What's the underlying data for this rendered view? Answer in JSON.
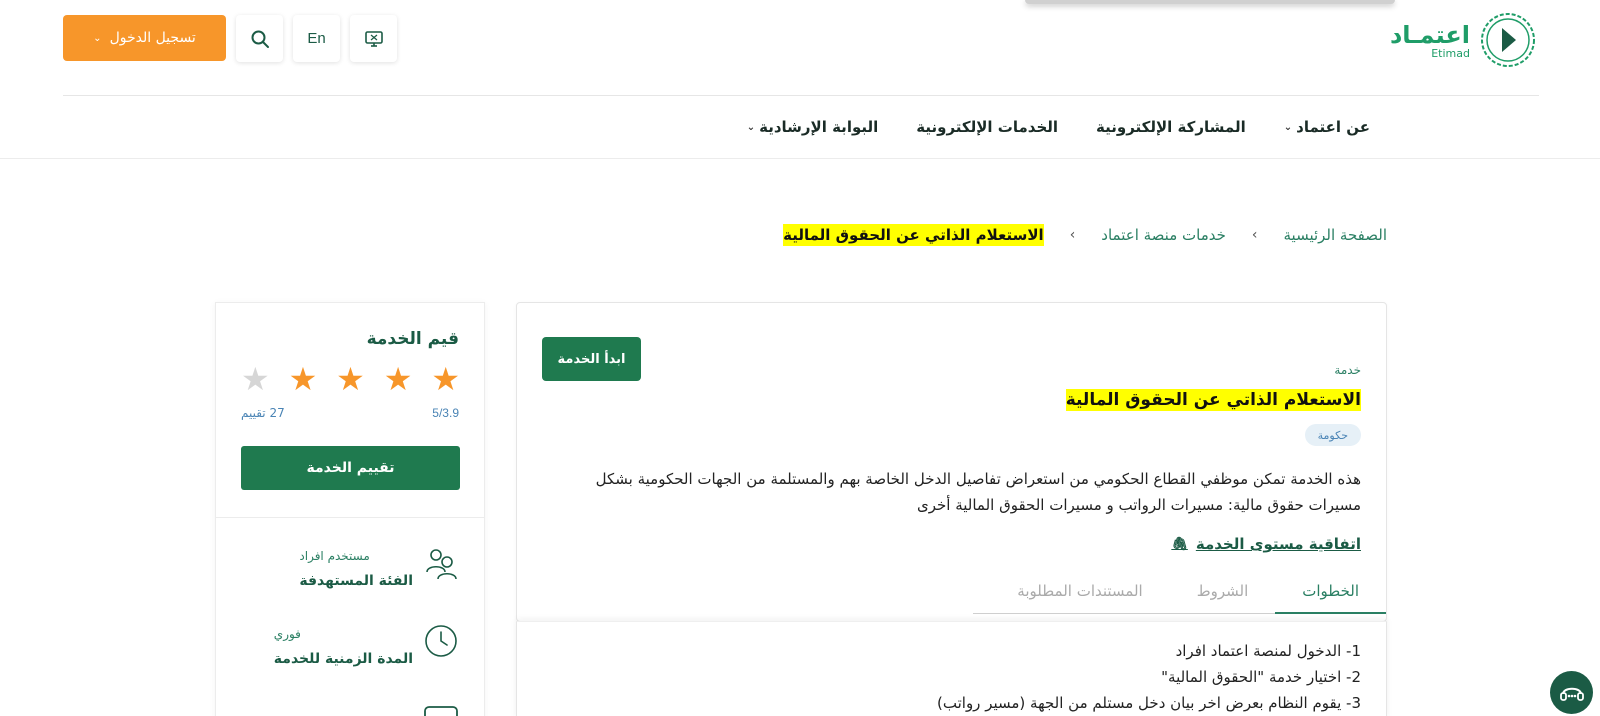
{
  "header": {
    "logo_ar": "اعتمـاد",
    "logo_en": "Etimad",
    "login_label": "تسجيل الدخول",
    "lang_label": "En",
    "search_icon": "search-icon",
    "screen_icon": "monitor-icon"
  },
  "nav": {
    "items": [
      {
        "label": "عن اعتماد",
        "has_dropdown": true
      },
      {
        "label": "المشاركة الإلكترونية",
        "has_dropdown": false
      },
      {
        "label": "الخدمات الإلكترونية",
        "has_dropdown": false
      },
      {
        "label": "البوابة الإرشادية",
        "has_dropdown": true
      }
    ]
  },
  "breadcrumb": {
    "home": "الصفحة الرئيسية",
    "services": "خدمات منصة اعتماد",
    "current": "الاستعلام الذاتي عن الحقوق المالية",
    "separator": "›"
  },
  "service": {
    "kind": "خدمة",
    "title": "الاستعلام الذاتي عن الحقوق المالية",
    "tag": "حكومة",
    "start_button": "ابدأ الخدمة",
    "description": "هذه الخدمة تمكن موظفي القطاع الحكومي من استعراض تفاصيل الدخل الخاصة بهم والمستلمة من الجهات الحكومية بشكل مسيرات حقوق مالية: مسيرات الرواتب و مسيرات الحقوق المالية أخرى",
    "sla_link": "اتفاقية مستوى الخدمة",
    "tabs": [
      "الخطوات",
      "الشروط",
      "المستندات المطلوبة"
    ],
    "active_tab": "الخطوات",
    "steps": [
      "1- الدخول لمنصة اعتماد افراد",
      "2- اختيار خدمة \"الحقوق المالية\"",
      "3- يقوم النظام بعرض اخر بيان دخل مستلم من الجهة (مسير رواتب)"
    ]
  },
  "rating": {
    "title": "قيم الخدمة",
    "value_text": "5/3.9",
    "score": 3.9,
    "max": 5,
    "stars_filled": 4,
    "count_text": "27 تقييم",
    "button": "تقييم الخدمة"
  },
  "info": [
    {
      "icon": "users-icon",
      "value": "مستخدم افراد",
      "label": "الفئة المستهدفة"
    },
    {
      "icon": "clock-icon",
      "value": "فوري",
      "label": "المدة الزمنية للخدمة"
    }
  ],
  "colors": {
    "brand_green": "#1f7a4f",
    "accent_orange": "#f7962a",
    "highlight": "#ffff00",
    "link_green": "#2a7f63"
  }
}
